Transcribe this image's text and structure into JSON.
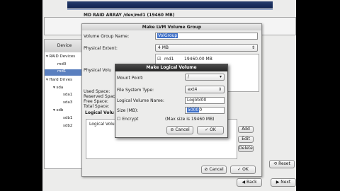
{
  "main": {
    "raid_header": "MD RAID ARRAY /dev/md1 (19460 MB)",
    "device_column": "Device",
    "tree": [
      "RAID Devices",
      "md0",
      "md1",
      "Hard Drives",
      "sda",
      "sda1",
      "sda3",
      "sdb",
      "sdb1",
      "sdb2"
    ],
    "reset_button": "Reset",
    "back_button": "Back",
    "next_button": "Next"
  },
  "vg_dialog": {
    "title": "Make LVM Volume Group",
    "vg_name_label": "Volume Group Name:",
    "vg_name_value": "VolGroup",
    "extent_label": "Physical Extent:",
    "extent_value": "4 MB",
    "pv_partial_label": "Physical Volu",
    "pv_name": "md1",
    "pv_size": "19460.00 MB",
    "used_label": "Used Space:",
    "reserved_label": "Reserved Space",
    "free_label": "Free Space:",
    "total_label": "Total Space:",
    "lv_section_label": "Logical Volu",
    "lv_column": "Logical Volu",
    "add_button": "Add",
    "edit_button": "Edit",
    "delete_button": "Delete",
    "cancel_button": "Cancel",
    "ok_button": "OK"
  },
  "lv_dialog": {
    "title": "Make Logical Volume",
    "mount_label": "Mount Point:",
    "mount_value": "/",
    "fs_label": "File System Type:",
    "fs_value": "ext4",
    "lv_name_label": "Logical Volume Name:",
    "lv_name_value": "LogVol00",
    "size_label": "Size (MB):",
    "size_value": "5000",
    "size_unit": "0",
    "encrypt_label": "Encrypt",
    "max_size": "(Max size is 19460 MB)",
    "cancel_button": "Cancel",
    "ok_button": "OK"
  }
}
